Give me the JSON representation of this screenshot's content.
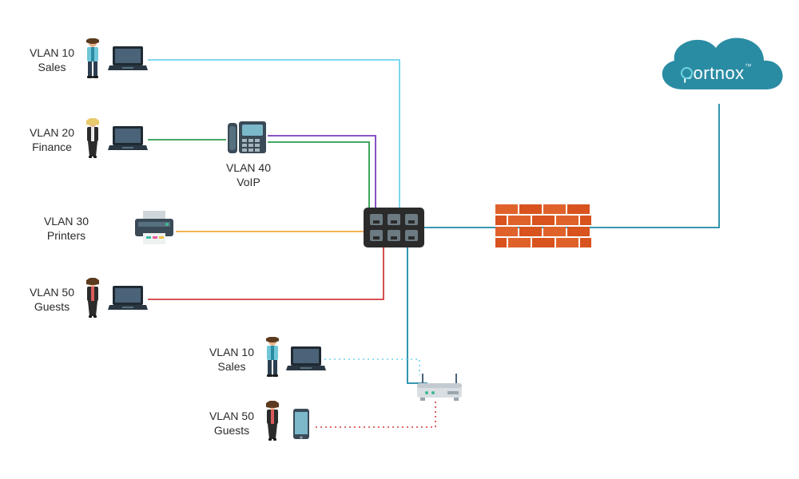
{
  "brand": {
    "name": "portnox",
    "tm": "™"
  },
  "labels": {
    "vlan10": "VLAN 10",
    "sales": "Sales",
    "vlan20": "VLAN 20",
    "finance": "Finance",
    "vlan30": "VLAN 30",
    "printers": "Printers",
    "vlan40": "VLAN 40",
    "voip": "VoIP",
    "vlan50": "VLAN 50",
    "guests": "Guests",
    "vlan10b": "VLAN 10",
    "salesb": "Sales",
    "vlan50b": "VLAN 50",
    "guestsb": "Guests"
  },
  "colors": {
    "vlan10": "#6fd4ee",
    "vlan20": "#2e9b4f",
    "vlan30": "#f0a93c",
    "vlan40": "#7a3fbf",
    "vlan50": "#d23b3b",
    "trunk": "#1d8aa8",
    "cloud": "#2a8ca3",
    "firewall": "#e0622b",
    "switch": "#2b2b2b",
    "laptop": "#1f2a33"
  },
  "chart_data": {
    "type": "diagram",
    "title": "VLAN network topology with Portnox cloud",
    "nodes": [
      {
        "id": "sales-user",
        "type": "person+laptop",
        "vlan": 10,
        "label": "VLAN 10 Sales"
      },
      {
        "id": "finance-user",
        "type": "person+laptop",
        "vlan": 20,
        "label": "VLAN 20 Finance"
      },
      {
        "id": "voip-phone",
        "type": "ip-phone",
        "vlan": 40,
        "label": "VLAN 40 VoIP"
      },
      {
        "id": "printer",
        "type": "printer",
        "vlan": 30,
        "label": "VLAN 30 Printers"
      },
      {
        "id": "guest-user",
        "type": "person+laptop",
        "vlan": 50,
        "label": "VLAN 50 Guests"
      },
      {
        "id": "switch",
        "type": "switch"
      },
      {
        "id": "firewall",
        "type": "firewall"
      },
      {
        "id": "cloud",
        "type": "cloud",
        "label": "portnox"
      },
      {
        "id": "wireless-ap",
        "type": "wireless-router"
      },
      {
        "id": "sales-wifi",
        "type": "person+laptop",
        "vlan": 10,
        "label": "VLAN 10 Sales"
      },
      {
        "id": "guest-wifi",
        "type": "person+phone",
        "vlan": 50,
        "label": "VLAN 50 Guests"
      }
    ],
    "edges": [
      {
        "from": "sales-user",
        "to": "switch",
        "vlan": 10,
        "color": "#6fd4ee"
      },
      {
        "from": "finance-user",
        "to": "voip-phone",
        "vlan": 20,
        "color": "#2e9b4f"
      },
      {
        "from": "voip-phone",
        "to": "switch",
        "vlan": 20,
        "color": "#2e9b4f"
      },
      {
        "from": "voip-phone",
        "to": "switch",
        "vlan": 40,
        "color": "#7a3fbf"
      },
      {
        "from": "printer",
        "to": "switch",
        "vlan": 30,
        "color": "#f0a93c"
      },
      {
        "from": "guest-user",
        "to": "switch",
        "vlan": 50,
        "color": "#d23b3b"
      },
      {
        "from": "switch",
        "to": "firewall",
        "color": "#1d8aa8"
      },
      {
        "from": "firewall",
        "to": "cloud",
        "color": "#1d8aa8"
      },
      {
        "from": "switch",
        "to": "wireless-ap",
        "color": "#1d8aa8"
      },
      {
        "from": "sales-wifi",
        "to": "wireless-ap",
        "vlan": 10,
        "color": "#6fd4ee",
        "style": "dotted"
      },
      {
        "from": "guest-wifi",
        "to": "wireless-ap",
        "vlan": 50,
        "color": "#d23b3b",
        "style": "dotted"
      }
    ]
  }
}
